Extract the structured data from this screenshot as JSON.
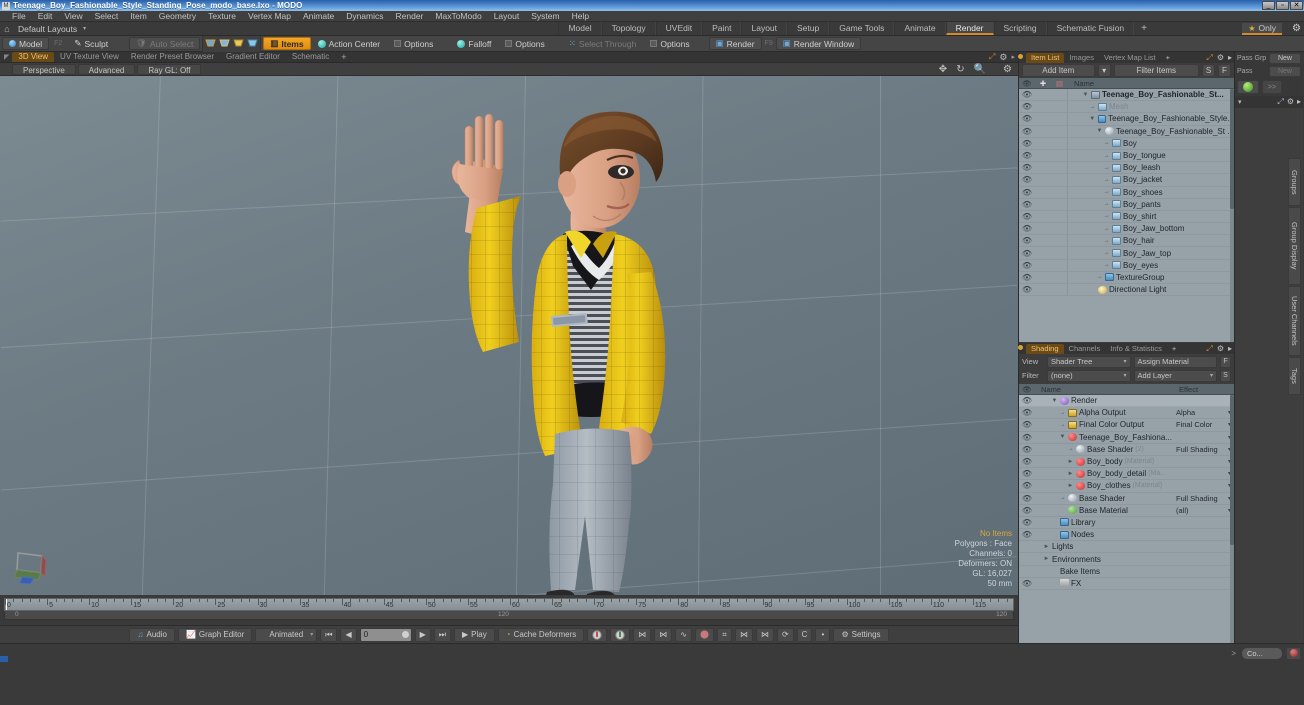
{
  "window": {
    "title": "Teenage_Boy_Fashionable_Style_Standing_Pose_modo_base.lxo - MODO",
    "minimize": "_",
    "maximize": "▫",
    "close": "✕"
  },
  "menubar": {
    "items": [
      "File",
      "Edit",
      "View",
      "Select",
      "Item",
      "Geometry",
      "Texture",
      "Vertex Map",
      "Animate",
      "Dynamics",
      "Render",
      "MaxToModo",
      "Layout",
      "System",
      "Help"
    ]
  },
  "layoutrow": {
    "home_icon": "home-icon",
    "layout_name": "Default Layouts",
    "caret": "▾",
    "mode_tabs": [
      "Model",
      "Topology",
      "UVEdit",
      "Paint",
      "Layout",
      "Setup",
      "Game Tools",
      "Animate",
      "Render",
      "Scripting",
      "Schematic Fusion"
    ],
    "active_mode_tab": "Render",
    "add_tab": "+",
    "only_label": "Only",
    "gear": "gear-icon"
  },
  "toolbar": {
    "model_label": "Model",
    "f2_label": "F2",
    "sculpt_label": "Sculpt",
    "auto_select_label": "Auto Select",
    "items_label": "Items",
    "action_center_label": "Action Center",
    "options_label_1": "Options",
    "falloff_label": "Falloff",
    "options_label_2": "Options",
    "select_through_label": "Select Through",
    "options_label_3": "Options",
    "render_label": "Render",
    "render_f9": "F9",
    "render_window_label": "Render Window"
  },
  "viewport": {
    "tabs": [
      "3D View",
      "UV Texture View",
      "Render Preset Browser",
      "Gradient Editor",
      "Schematic"
    ],
    "active_tab": "3D View",
    "add_tab": "+",
    "buttons": [
      "Perspective",
      "Advanced",
      "Ray GL: Off"
    ],
    "header_icons": [
      "move-icon",
      "rotate-icon",
      "zoom-icon",
      "gear-icon"
    ],
    "stats": {
      "no_items": "No Items",
      "polygons": "Polygons : Face",
      "channels": "Channels: 0",
      "deformers": "Deformers: ON",
      "gl": "GL: 16,027",
      "units": "50 mm"
    }
  },
  "timeline": {
    "ticks": [
      0,
      5,
      10,
      15,
      20,
      25,
      30,
      35,
      40,
      45,
      50,
      55,
      60,
      65,
      70,
      75,
      80,
      85,
      90,
      95,
      100,
      105,
      110,
      115,
      120
    ],
    "start_value": "0",
    "end_value": "120",
    "mid_value": "120",
    "cursor_frame": 0
  },
  "playbar": {
    "audio_label": "Audio",
    "graph_editor_label": "Graph Editor",
    "animated_label": "Animated",
    "frame_value": "0",
    "play_label": "Play",
    "cache_deformers_label": "Cache Deformers",
    "settings_label": "Settings",
    "transport": [
      "⏮",
      "◀",
      "▶",
      "⏭"
    ]
  },
  "item_list": {
    "tabs": [
      "Item List",
      "Images",
      "Vertex Map List"
    ],
    "active_tab": "Item List",
    "add_tab": "+",
    "add_item_label": "Add Item",
    "add_item_caret": "▾",
    "filter_items_label": "Filter Items",
    "btn_s": "S",
    "btn_f": "F",
    "columns": [
      "Name"
    ],
    "col_icon_a": "plus-icon",
    "col_icon_b": "render-icon",
    "rows": [
      {
        "label": "Teenage_Boy_Fashionable_St...",
        "indent": 2,
        "icon": "grp",
        "tw": "▼",
        "bold": true,
        "dim": false
      },
      {
        "label": "Mesh",
        "indent": 3,
        "icon": "mesh",
        "tw": "→",
        "bold": false,
        "dim": true
      },
      {
        "label": "Teenage_Boy_Fashionable_Style...",
        "indent": 3,
        "icon": "folder",
        "tw": "▼",
        "bold": false,
        "dim": false
      },
      {
        "label": "Teenage_Boy_Fashionable_St ...",
        "indent": 4,
        "icon": "sph",
        "tw": "▼",
        "bold": false,
        "dim": false
      },
      {
        "label": "Boy",
        "indent": 5,
        "icon": "mesh",
        "tw": "→",
        "bold": false,
        "dim": false
      },
      {
        "label": "Boy_tongue",
        "indent": 5,
        "icon": "mesh",
        "tw": "→",
        "bold": false,
        "dim": false
      },
      {
        "label": "Boy_leash",
        "indent": 5,
        "icon": "mesh",
        "tw": "→",
        "bold": false,
        "dim": false
      },
      {
        "label": "Boy_jacket",
        "indent": 5,
        "icon": "mesh",
        "tw": "→",
        "bold": false,
        "dim": false
      },
      {
        "label": "Boy_shoes",
        "indent": 5,
        "icon": "mesh",
        "tw": "→",
        "bold": false,
        "dim": false
      },
      {
        "label": "Boy_pants",
        "indent": 5,
        "icon": "mesh",
        "tw": "→",
        "bold": false,
        "dim": false
      },
      {
        "label": "Boy_shirt",
        "indent": 5,
        "icon": "mesh",
        "tw": "→",
        "bold": false,
        "dim": false
      },
      {
        "label": "Boy_Jaw_bottom",
        "indent": 5,
        "icon": "mesh",
        "tw": "→",
        "bold": false,
        "dim": false
      },
      {
        "label": "Boy_hair",
        "indent": 5,
        "icon": "mesh",
        "tw": "→",
        "bold": false,
        "dim": false
      },
      {
        "label": "Boy_Jaw_top",
        "indent": 5,
        "icon": "mesh",
        "tw": "→",
        "bold": false,
        "dim": false
      },
      {
        "label": "Boy_eyes",
        "indent": 5,
        "icon": "mesh",
        "tw": "→",
        "bold": false,
        "dim": false
      },
      {
        "label": "TextureGroup",
        "indent": 4,
        "icon": "folder",
        "tw": "→",
        "bold": false,
        "dim": false
      },
      {
        "label": "Directional Light",
        "indent": 3,
        "icon": "light",
        "tw": "",
        "bold": false,
        "dim": false
      }
    ]
  },
  "shading": {
    "tabs": [
      "Shading",
      "Channels",
      "Info & Statistics"
    ],
    "active_tab": "Shading",
    "add_tab": "+",
    "view_label": "View",
    "view_value": "Shader Tree",
    "assign_material_label": "Assign Material",
    "btn_f": "F",
    "filter_label": "Filter",
    "filter_value": "(none)",
    "add_layer_label": "Add Layer",
    "btn_s": "S",
    "col_name": "Name",
    "col_effect": "Effect",
    "rows": [
      {
        "label": "Render",
        "effect": "",
        "indent": 2,
        "icon": "pur",
        "tw": "▼",
        "selected": true,
        "sub": ""
      },
      {
        "label": "Alpha Output",
        "effect": "Alpha",
        "indent": 3,
        "icon": "img",
        "tw": "→",
        "selected": false,
        "sub": ""
      },
      {
        "label": "Final Color Output",
        "effect": "Final Color",
        "indent": 3,
        "icon": "img",
        "tw": "→",
        "selected": false,
        "sub": ""
      },
      {
        "label": "Teenage_Boy_Fashiona...",
        "effect": "",
        "indent": 3,
        "icon": "red",
        "tw": "▼",
        "selected": false,
        "sub": ""
      },
      {
        "label": "Base Shader",
        "effect": "Full Shading",
        "indent": 4,
        "icon": "sph",
        "tw": "→",
        "selected": false,
        "sub": "(2)"
      },
      {
        "label": "Boy_body",
        "effect": "",
        "indent": 4,
        "icon": "red",
        "tw": "►",
        "selected": false,
        "sub": "(Material)"
      },
      {
        "label": "Boy_body_detail",
        "effect": "",
        "indent": 4,
        "icon": "red",
        "tw": "►",
        "selected": false,
        "sub": "(Ma..."
      },
      {
        "label": "Boy_clothes",
        "effect": "",
        "indent": 4,
        "icon": "red",
        "tw": "►",
        "selected": false,
        "sub": "(Material)"
      },
      {
        "label": "Base Shader",
        "effect": "Full Shading",
        "indent": 3,
        "icon": "sph",
        "tw": "→",
        "selected": false,
        "sub": ""
      },
      {
        "label": "Base Material",
        "effect": "(all)",
        "indent": 3,
        "icon": "grn",
        "tw": "",
        "selected": false,
        "sub": ""
      },
      {
        "label": "Library",
        "effect": "",
        "indent": 2,
        "icon": "folder",
        "tw": "",
        "selected": false,
        "sub": ""
      },
      {
        "label": "Nodes",
        "effect": "",
        "indent": 2,
        "icon": "folder",
        "tw": "",
        "selected": false,
        "sub": ""
      },
      {
        "label": "Lights",
        "effect": "",
        "indent": 1,
        "icon": "none",
        "tw": "►",
        "selected": false,
        "sub": ""
      },
      {
        "label": "Environments",
        "effect": "",
        "indent": 1,
        "icon": "none",
        "tw": "►",
        "selected": false,
        "sub": ""
      },
      {
        "label": "Bake Items",
        "effect": "",
        "indent": 2,
        "icon": "none",
        "tw": "",
        "selected": false,
        "sub": ""
      },
      {
        "label": "FX",
        "effect": "",
        "indent": 2,
        "icon": "fx",
        "tw": "",
        "selected": false,
        "sub": ""
      }
    ]
  },
  "far_panel": {
    "pass_grp_label": "Pass Grp",
    "pass_grp_btn": "New",
    "pass_label": "Pass",
    "pass_btn": "New",
    "refresh_icon": "refresh-icon",
    "more_btn": ">>",
    "vertical_tabs": [
      "Groups",
      "Group Display",
      "User Channels",
      "Tags"
    ]
  },
  "statusbar": {
    "arrow": ">",
    "command_value": "Co...",
    "record_icon": "record-icon"
  },
  "colors": {
    "accent_orange": "#e08c10",
    "title_blue": "#5a97d8",
    "panel_bg": "#3a3a3a",
    "list_bg": "#97a1a8",
    "viewport_bg": "#6d7b84",
    "jacket_yellow": "#e8c018"
  }
}
